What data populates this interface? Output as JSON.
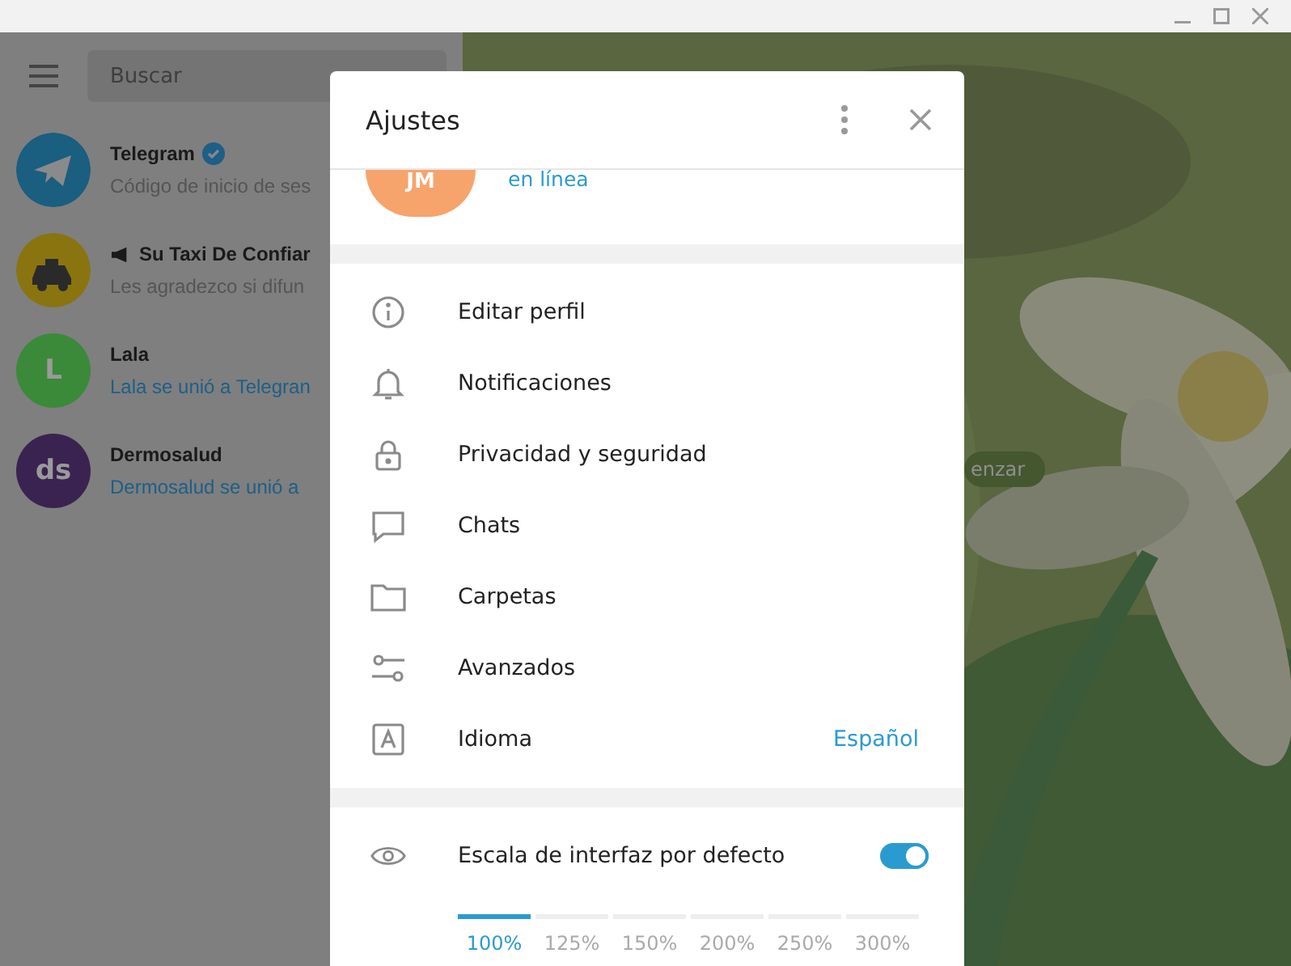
{
  "search": {
    "placeholder": "Buscar"
  },
  "chats": [
    {
      "kind": "telegram",
      "name": "Telegram",
      "verified": true,
      "channel": false,
      "preview": "Código de inicio de ses",
      "preview_link": false
    },
    {
      "kind": "taxi",
      "name": "Su Taxi De Confiar",
      "verified": false,
      "channel": true,
      "preview": "Les agradezco si difun",
      "preview_link": false
    },
    {
      "kind": "letter",
      "initial": "L",
      "color": "#3a8a3a",
      "name": "Lala",
      "verified": false,
      "channel": false,
      "preview": "Lala se unió a Telegran",
      "preview_link": true
    },
    {
      "kind": "letter",
      "initial": "ds",
      "color": "#3a2350",
      "name": "Dermosalud",
      "verified": false,
      "channel": false,
      "preview": "Dermosalud se unió a",
      "preview_link": true
    }
  ],
  "background_pill": "enzar",
  "settings": {
    "title": "Ajustes",
    "initials": "JM",
    "status": "en línea",
    "items": [
      {
        "kind": "info",
        "label": "Editar perfil"
      },
      {
        "kind": "bell",
        "label": "Notificaciones"
      },
      {
        "kind": "lock",
        "label": "Privacidad y seguridad"
      },
      {
        "kind": "chat",
        "label": "Chats"
      },
      {
        "kind": "folder",
        "label": "Carpetas"
      },
      {
        "kind": "sliders",
        "label": "Avanzados"
      },
      {
        "kind": "language",
        "label": "Idioma",
        "value": "Español"
      }
    ],
    "scale": {
      "label": "Escala de interfaz por defecto",
      "on": true,
      "options": [
        {
          "label": "100%",
          "selected": true
        },
        {
          "label": "125%",
          "selected": false
        },
        {
          "label": "150%",
          "selected": false
        },
        {
          "label": "200%",
          "selected": false
        },
        {
          "label": "250%",
          "selected": false
        },
        {
          "label": "300%",
          "selected": false
        }
      ]
    }
  }
}
